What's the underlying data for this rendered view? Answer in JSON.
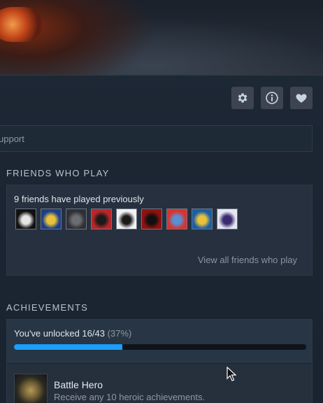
{
  "toolbar": {
    "settings_icon": "gear-icon",
    "info_icon": "info-icon",
    "favorite_icon": "heart-icon"
  },
  "support_bar": {
    "label": "upport"
  },
  "friends": {
    "section_title": "FRIENDS WHO PLAY",
    "count_text": "9 friends have played previously",
    "avatars": [
      {
        "colors": [
          "#111111",
          "#e6e6e6"
        ]
      },
      {
        "colors": [
          "#1c3f86",
          "#e8c23a"
        ]
      },
      {
        "colors": [
          "#2e3036",
          "#6a6d72"
        ]
      },
      {
        "colors": [
          "#b8262a",
          "#1a1a1a"
        ]
      },
      {
        "colors": [
          "#f2f2f2",
          "#1a1a1a"
        ]
      },
      {
        "colors": [
          "#8f1111",
          "#101010"
        ]
      },
      {
        "colors": [
          "#d9332e",
          "#5a8fd1"
        ]
      },
      {
        "colors": [
          "#1c5ea6",
          "#e8c23a"
        ]
      },
      {
        "colors": [
          "#e6e6f2",
          "#3a2a6e"
        ]
      }
    ],
    "view_all_label": "View all friends who play"
  },
  "achievements": {
    "section_title": "ACHIEVEMENTS",
    "unlocked_text": "You've unlocked 16/43",
    "percent_text": "(37%)",
    "progress": 0.37,
    "items": [
      {
        "name": "Battle Hero",
        "description": "Receive any 10 heroic achievements."
      }
    ]
  },
  "colors": {
    "accent": "#1a9fff",
    "background": "#1b2838"
  }
}
